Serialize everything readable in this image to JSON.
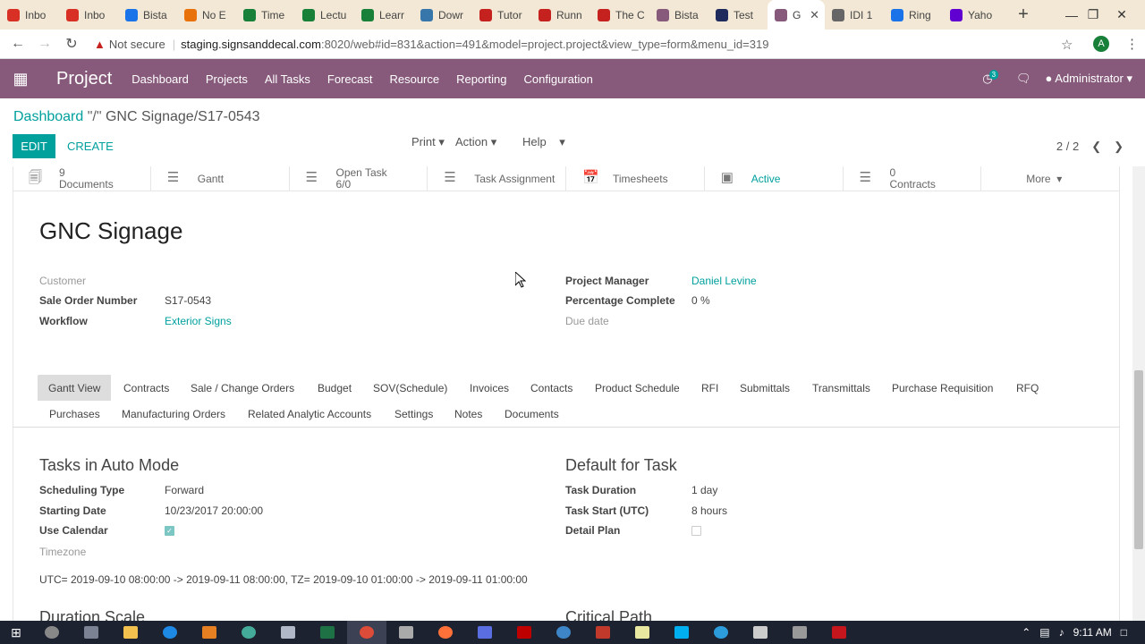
{
  "browser": {
    "tabs": [
      {
        "label": "Inbo",
        "icon": "gmail-icon",
        "color": "#d93025"
      },
      {
        "label": "Inbo",
        "icon": "gmail-icon",
        "color": "#d93025"
      },
      {
        "label": "Bista",
        "icon": "calendar-icon",
        "color": "#1a73e8"
      },
      {
        "label": "No E",
        "icon": "flower-icon",
        "color": "#e8710a"
      },
      {
        "label": "Time",
        "icon": "drive-icon",
        "color": "#188038"
      },
      {
        "label": "Lectu",
        "icon": "chart-icon",
        "color": "#188038"
      },
      {
        "label": "Learr",
        "icon": "chart-icon",
        "color": "#188038"
      },
      {
        "label": "Dowr",
        "icon": "python-icon",
        "color": "#3776ab"
      },
      {
        "label": "Tutor",
        "icon": "opera-icon",
        "color": "#c5221f"
      },
      {
        "label": "Runn",
        "icon": "cs-icon",
        "color": "#c5221f"
      },
      {
        "label": "The C",
        "icon": "aa-icon",
        "color": "#c5221f"
      },
      {
        "label": "Bista",
        "icon": "odoo-icon",
        "color": "#875a7b"
      },
      {
        "label": "Test",
        "icon": "v-icon",
        "color": "#1f2b5c"
      },
      {
        "label": "G",
        "icon": "odoo-icon",
        "color": "#875a7b"
      },
      {
        "label": "IDI 1",
        "icon": "globe-icon",
        "color": "#666666"
      },
      {
        "label": "Ring",
        "icon": "r-icon",
        "color": "#1a73e8"
      },
      {
        "label": "Yaho",
        "icon": "yahoo-icon",
        "color": "#6001d2"
      }
    ],
    "new_tab": "+",
    "not_secure": "Not secure",
    "url_host": "staging.signsanddecal.com",
    "url_rest": ":8020/web#id=831&action=491&model=project.project&view_type=form&menu_id=319",
    "profile_initial": "A"
  },
  "nav": {
    "brand": "Project",
    "menus": [
      "Dashboard",
      "Projects",
      "All Tasks",
      "Forecast",
      "Resource",
      "Reporting",
      "Configuration"
    ],
    "notif_count": "3",
    "user": "Administrator"
  },
  "control": {
    "breadcrumb_root": "Dashboard",
    "breadcrumb_sep": " \"/\" ",
    "breadcrumb_current": "GNC Signage/S17-0543",
    "edit": "EDIT",
    "create": "CREATE",
    "print": "Print",
    "action": "Action",
    "help": "Help",
    "pager": "2 / 2"
  },
  "smart_buttons": [
    {
      "line1": "9",
      "line2": "Documents",
      "icon": "documents-icon"
    },
    {
      "line1": "Gantt",
      "line2": "",
      "icon": "list-icon"
    },
    {
      "line1": "Open Task",
      "line2": "6/0",
      "icon": "list-icon"
    },
    {
      "line1": "Task Assignment",
      "line2": "",
      "icon": "list-icon"
    },
    {
      "line1": "Timesheets",
      "line2": "",
      "icon": "calendar-icon"
    },
    {
      "line1": "Active",
      "line2": "",
      "icon": "archive-icon"
    },
    {
      "line1": "0",
      "line2": "Contracts",
      "icon": "list-icon"
    },
    {
      "line1": "More",
      "line2": "",
      "icon": ""
    }
  ],
  "form": {
    "title": "GNC Signage",
    "customer_label": "Customer",
    "sale_order_label": "Sale Order Number",
    "sale_order_value": "S17-0543",
    "workflow_label": "Workflow",
    "workflow_value": "Exterior Signs",
    "pm_label": "Project Manager",
    "pm_value": "Daniel Levine",
    "pct_label": "Percentage Complete",
    "pct_value": "0 %",
    "due_label": "Due date"
  },
  "notebook": {
    "row1": [
      "Gantt View",
      "Contracts",
      "Sale / Change Orders",
      "Budget",
      "SOV(Schedule)",
      "Invoices",
      "Contacts",
      "Product Schedule",
      "RFI",
      "Submittals",
      "Transmittals",
      "Purchase Requisition",
      "RFQ"
    ],
    "row2": [
      "Purchases",
      "Manufacturing Orders",
      "Related Analytic Accounts",
      "Settings",
      "Notes",
      "Documents"
    ]
  },
  "gantt": {
    "auto_title": "Tasks in Auto Mode",
    "sched_label": "Scheduling Type",
    "sched_value": "Forward",
    "start_label": "Starting Date",
    "start_value": "10/23/2017 20:00:00",
    "calendar_label": "Use Calendar",
    "calendar_checked": true,
    "tz_label": "Timezone",
    "utc_line": "UTC= 2019-09-10 08:00:00 -> 2019-09-11 08:00:00, TZ= 2019-09-10 01:00:00 -> 2019-09-11 01:00:00",
    "default_title": "Default for Task",
    "duration_label": "Task Duration",
    "duration_value": "1 day",
    "taskstart_label": "Task Start (UTC)",
    "taskstart_value": "8 hours",
    "detail_label": "Detail Plan",
    "detail_checked": false,
    "duration_scale_title": "Duration Scale",
    "critical_path_title": "Critical Path"
  },
  "taskbar": {
    "clock": "9:11 AM"
  }
}
